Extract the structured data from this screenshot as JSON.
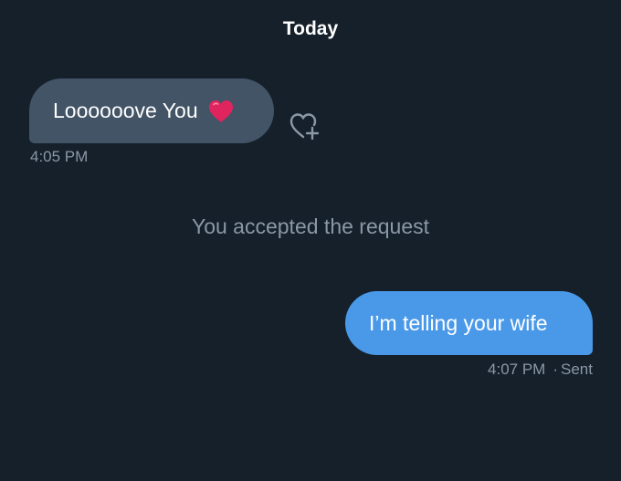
{
  "conversation": {
    "date_header": "Today",
    "incoming_message": {
      "text": "Loooooove You",
      "emoji": "red-heart",
      "timestamp": "4:05 PM",
      "reaction_button_icon": "heart-plus-icon"
    },
    "system_message": "You accepted the request",
    "outgoing_message": {
      "text": "I’m telling your wife",
      "timestamp": "4:07 PM",
      "separator": "·",
      "status": "Sent"
    }
  },
  "colors": {
    "background": "#15202b",
    "incoming_bubble": "#425466",
    "outgoing_bubble": "#4a99e9",
    "secondary_text": "#8b98a5",
    "heart_emoji": "#e0245e"
  }
}
